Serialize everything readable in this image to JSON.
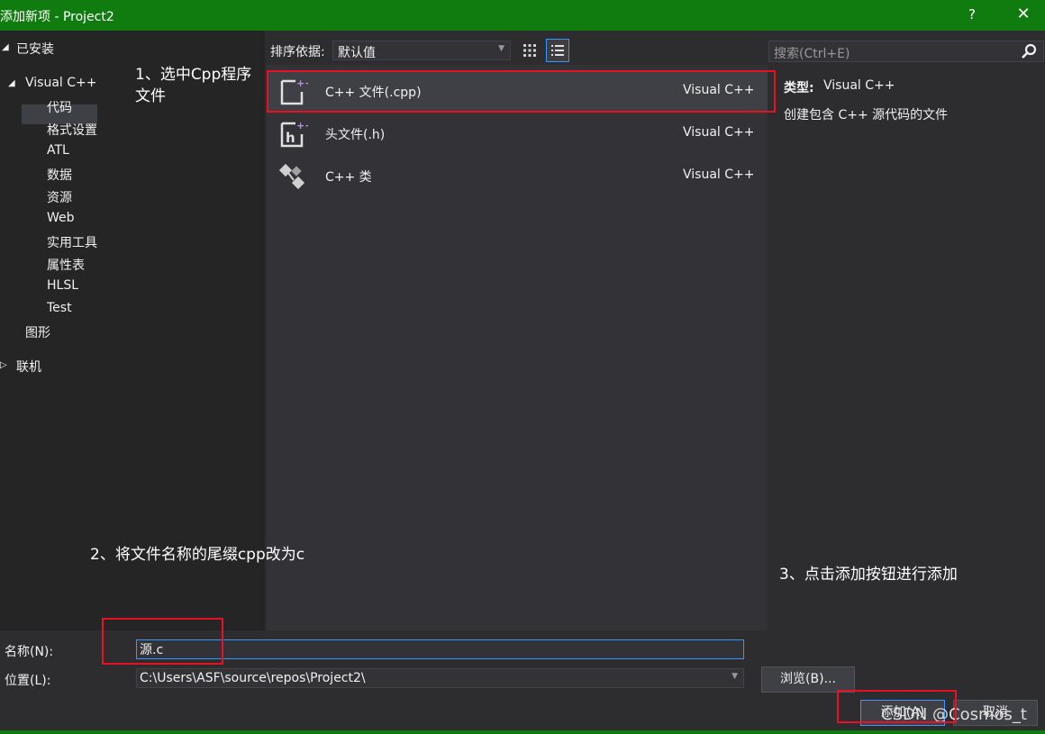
{
  "window": {
    "title": "添加新项 - Project2",
    "help": "?",
    "close": "✕"
  },
  "tree": {
    "installed": "已安装",
    "visual_cpp": "Visual C++",
    "children": [
      "代码",
      "格式设置",
      "ATL",
      "数据",
      "资源",
      "Web",
      "实用工具",
      "属性表",
      "HLSL",
      "Test"
    ],
    "graphics": "图形",
    "online": "联机"
  },
  "toolbar": {
    "sort_label": "排序依据:",
    "sort_value": "默认值"
  },
  "templates": [
    {
      "name": "C++ 文件(.cpp)",
      "lang": "Visual C++",
      "icon": "cpp-file-icon"
    },
    {
      "name": "头文件(.h)",
      "lang": "Visual C++",
      "icon": "header-file-icon"
    },
    {
      "name": "C++ 类",
      "lang": "Visual C++",
      "icon": "cpp-class-icon"
    }
  ],
  "search": {
    "placeholder": "搜索(Ctrl+E)"
  },
  "details": {
    "type_label": "类型:",
    "type_value": "Visual C++",
    "description": "创建包含 C++ 源代码的文件"
  },
  "annotations": {
    "step1_line1": "1、选中Cpp程序",
    "step1_line2": "文件",
    "step2": "2、将文件名称的尾缀cpp改为c",
    "step3": "3、点击添加按钮进行添加"
  },
  "form": {
    "name_label": "名称(N):",
    "name_value": "源.c",
    "location_label": "位置(L):",
    "location_value": "C:\\Users\\ASF\\source\\repos\\Project2\\",
    "browse": "浏览(B)...",
    "add": "添加(A)",
    "cancel": "取消"
  },
  "watermark": "CSDN @Cosmos_t",
  "colors": {
    "titlebar": "#107c10",
    "background": "#2d2d30",
    "annotation_box": "#e81123",
    "accent": "#3399ff"
  }
}
